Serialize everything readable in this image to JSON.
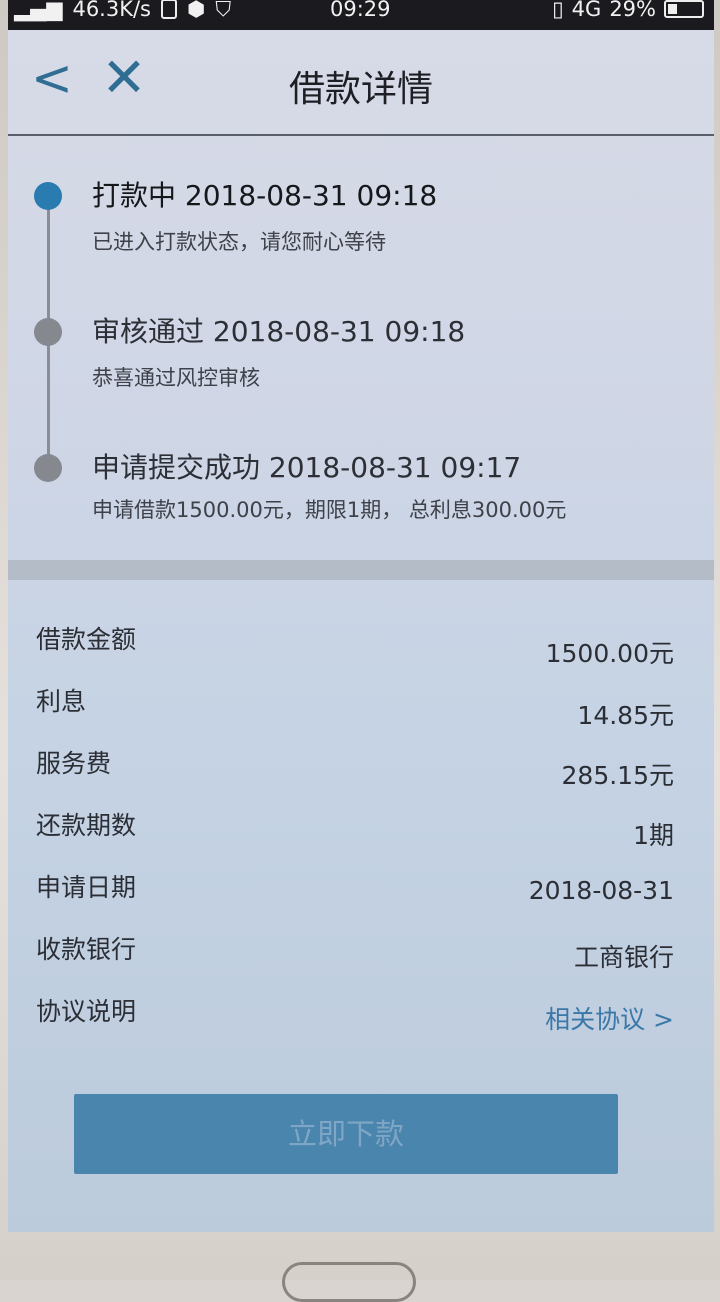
{
  "status_bar": {
    "speed": "46.3K/s",
    "time": "09:29",
    "network": "4G",
    "battery": "29%"
  },
  "nav": {
    "back_icon": "<",
    "close_icon": "✕",
    "title": "借款详情"
  },
  "timeline": [
    {
      "title": "打款中 2018-08-31 09:18",
      "desc": "已进入打款状态，请您耐心等待",
      "active": true
    },
    {
      "title": "审核通过 2018-08-31 09:18",
      "desc": "恭喜通过风控审核",
      "active": false
    },
    {
      "title": "申请提交成功 2018-08-31 09:17",
      "desc": "申请借款1500.00元，期限1期， 总利息300.00元",
      "active": false
    }
  ],
  "details": [
    {
      "label": "借款金额",
      "value": "1500.00元"
    },
    {
      "label": "利息",
      "value": "14.85元"
    },
    {
      "label": "服务费",
      "value": "285.15元"
    },
    {
      "label": "还款期数",
      "value": "1期"
    },
    {
      "label": "申请日期",
      "value": "2018-08-31"
    },
    {
      "label": "收款银行",
      "value": "工商银行"
    },
    {
      "label": "协议说明",
      "value": "相关协议 >"
    }
  ],
  "submit_button": "立即下款",
  "colors": {
    "accent": "#2a7bb0",
    "link": "#3b78a8",
    "button": "#4a85ad"
  }
}
